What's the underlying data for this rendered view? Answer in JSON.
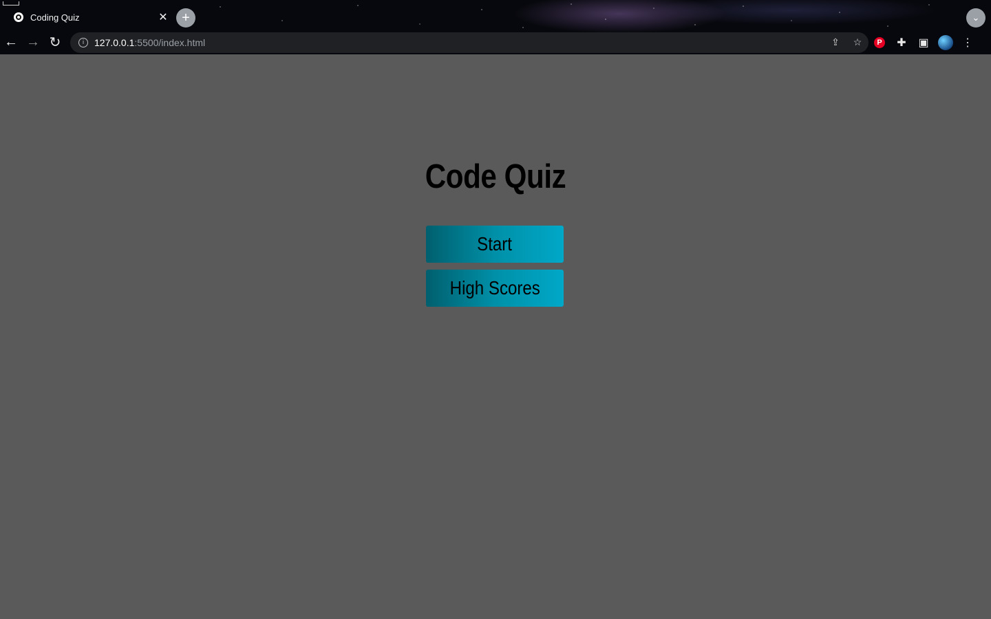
{
  "browser": {
    "tab": {
      "title": "Coding Quiz",
      "favicon": "globe-icon",
      "close_glyph": "✕"
    },
    "new_tab_glyph": "+",
    "tab_search_glyph": "⌄",
    "nav": {
      "back_glyph": "←",
      "forward_glyph": "→",
      "reload_glyph": "↻"
    },
    "address_bar": {
      "info_glyph": "i",
      "url_host": "127.0.0.1",
      "url_rest": ":5500/index.html"
    },
    "share_glyph": "⇪",
    "bookmark_glyph": "☆",
    "extensions": {
      "pinterest_glyph": "P",
      "puzzle_glyph": "✚",
      "sidepanel_glyph": "▣",
      "menu_glyph": "⋮"
    }
  },
  "page": {
    "background_color": "#5a5a5a",
    "title": "Code Quiz",
    "buttons": {
      "start_label": "Start",
      "high_scores_label": "High Scores"
    },
    "accent_gradient": [
      "#005f6e",
      "#00a8c8"
    ]
  }
}
